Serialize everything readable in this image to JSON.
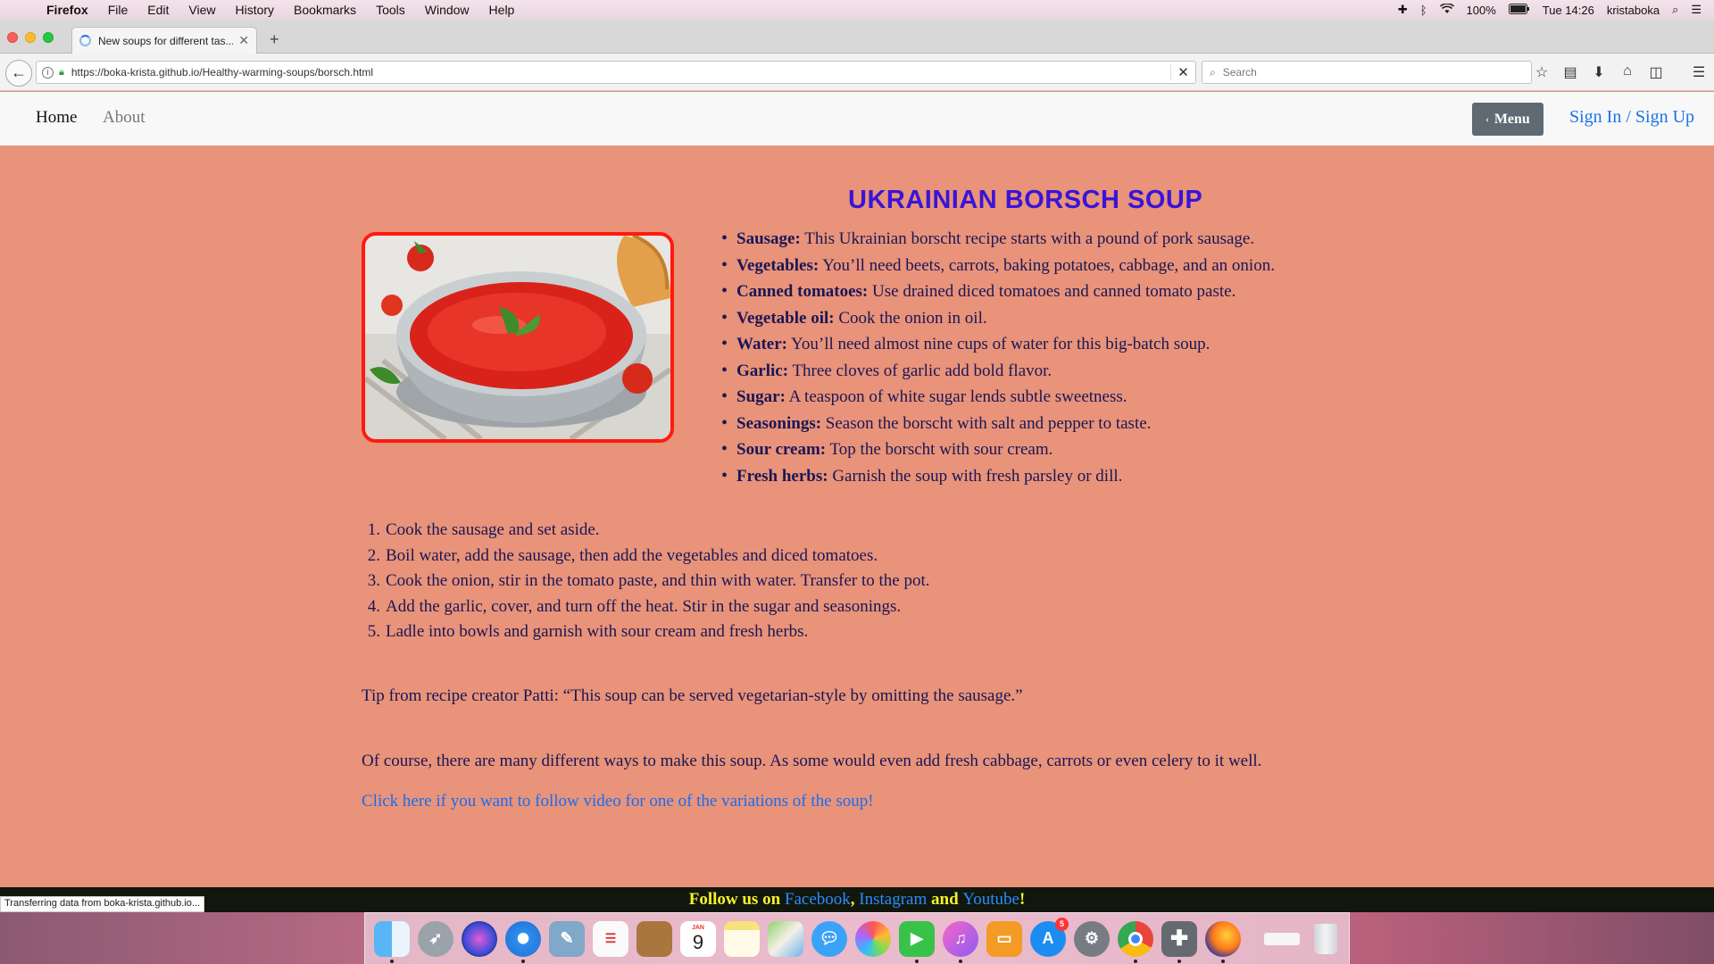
{
  "menubar": {
    "app": "Firefox",
    "items": [
      "File",
      "Edit",
      "View",
      "History",
      "Bookmarks",
      "Tools",
      "Window",
      "Help"
    ],
    "battery": "100%",
    "clock": "Tue 14:26",
    "user": "kristaboka"
  },
  "browser": {
    "tab_title": "New soups for different tas...",
    "url": "https://boka-krista.github.io/Healthy-warming-soups/borsch.html",
    "search_placeholder": "Search",
    "status_text": "Transferring data from boka-krista.github.io..."
  },
  "site_nav": {
    "home": "Home",
    "about": "About",
    "menu_button": "Menu",
    "signin": "Sign In / Sign Up"
  },
  "recipe": {
    "title": "UKRAINIAN BORSCH SOUP",
    "ingredients": [
      {
        "name": "Sausage:",
        "text": " This Ukrainian borscht recipe starts with a pound of pork sausage."
      },
      {
        "name": "Vegetables:",
        "text": " You’ll need beets, carrots, baking potatoes, cabbage, and an onion."
      },
      {
        "name": "Canned tomatoes:",
        "text": " Use drained diced tomatoes and canned tomato paste."
      },
      {
        "name": "Vegetable oil:",
        "text": " Cook the onion in oil."
      },
      {
        "name": "Water:",
        "text": " You’ll need almost nine cups of water for this big-batch soup."
      },
      {
        "name": "Garlic:",
        "text": " Three cloves of garlic add bold flavor."
      },
      {
        "name": "Sugar:",
        "text": " A teaspoon of white sugar lends subtle sweetness."
      },
      {
        "name": "Seasonings:",
        "text": " Season the borscht with salt and pepper to taste."
      },
      {
        "name": "Sour cream:",
        "text": " Top the borscht with sour cream."
      },
      {
        "name": "Fresh herbs:",
        "text": " Garnish the soup with fresh parsley or dill."
      }
    ],
    "steps": [
      "Cook the sausage and set aside.",
      "Boil water, add the sausage, then add the vegetables and diced tomatoes.",
      "Cook the onion, stir in the tomato paste, and thin with water. Transfer to the pot.",
      "Add the garlic, cover, and turn off the heat. Stir in the sugar and seasonings.",
      "Ladle into bowls and garnish with sour cream and fresh herbs."
    ],
    "tip": "Tip from recipe creator Patti: “This soup can be served vegetarian-style by omitting the sausage.”",
    "note": "Of course, there are many different ways to make this soup. As some would even add fresh cabbage, carrots or even celery to it well.",
    "video_link": "Click here if you want to follow video for one of the variations of the soup!"
  },
  "footer": {
    "prefix": "Follow us on ",
    "facebook": "Facebook",
    "comma": ", ",
    "instagram": "Instagram",
    "and": " and ",
    "youtube": "Youtube",
    "suffix": "!"
  },
  "dock": {
    "calendar_month": "JAN",
    "calendar_day": "9",
    "appstore_badge": "5",
    "icons": [
      "finder-icon",
      "launchpad-icon",
      "siri-icon",
      "safari-icon",
      "preview-icon",
      "reminders-icon",
      "notefile-icon",
      "calendar-icon",
      "notes-icon",
      "maps-icon",
      "messages-icon",
      "photos-icon",
      "facetime-icon",
      "itunes-icon",
      "ibooks-icon",
      "appstore-icon",
      "system-preferences-icon",
      "chrome-icon",
      "utility-icon",
      "firefox-icon",
      "downloads-stack-icon",
      "trash-icon"
    ]
  },
  "colors": {
    "page_bg": "#e8937a",
    "heading": "#3a14d6",
    "text": "#1a1654",
    "link": "#1a6cf0",
    "image_border": "#ff1a0e",
    "footer_bg": "#11170d",
    "footer_text": "#f7f22a"
  }
}
